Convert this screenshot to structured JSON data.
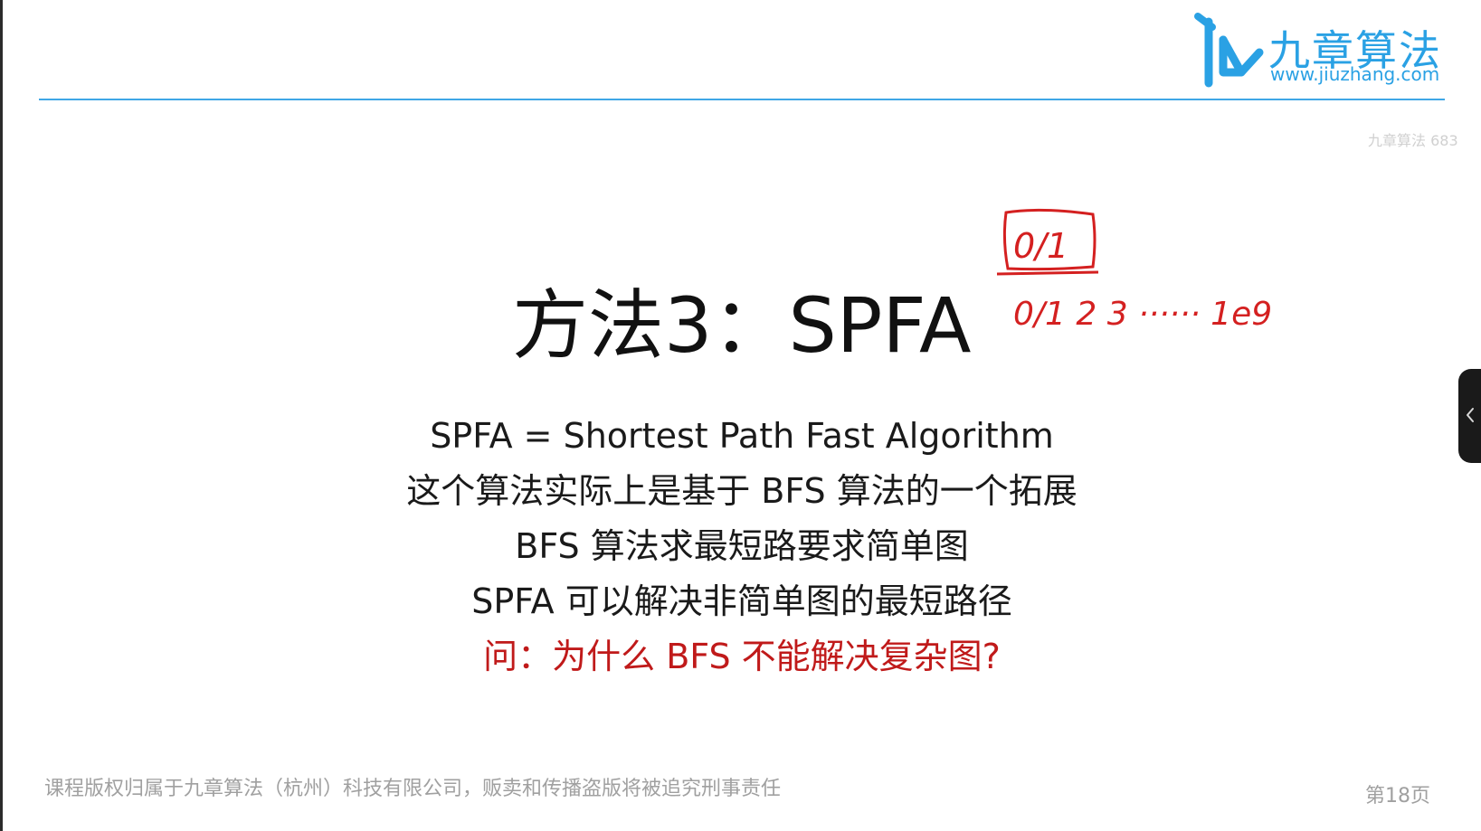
{
  "logo": {
    "name_cn": "九章算法",
    "url": "www.jiuzhang.com"
  },
  "watermark": "九章算法 683",
  "slide": {
    "title": "方法3：SPFA",
    "lines": [
      "SPFA = Shortest Path Fast Algorithm",
      "这个算法实际上是基于 BFS 算法的一个拓展",
      "BFS 算法求最短路要求简单图",
      "SPFA 可以解决非简单图的最短路径"
    ],
    "question": "问：为什么 BFS 不能解决复杂图?"
  },
  "handwriting": {
    "boxed_note": "0/1",
    "range_note": "0/1 2 3 ······ 1e9"
  },
  "footer": {
    "copyright": "课程版权归属于九章算法（杭州）科技有限公司，贩卖和传播盗版将被追究刑事责任",
    "page": "第18页"
  },
  "colors": {
    "accent": "#2aa1e4",
    "header_rule": "#3fa7e6",
    "question": "#c01a1a",
    "handwriting": "#d42020"
  },
  "icons": {
    "logo_mark": "jiuzhang-logo-icon",
    "side_panel": "chevron-left-icon"
  }
}
